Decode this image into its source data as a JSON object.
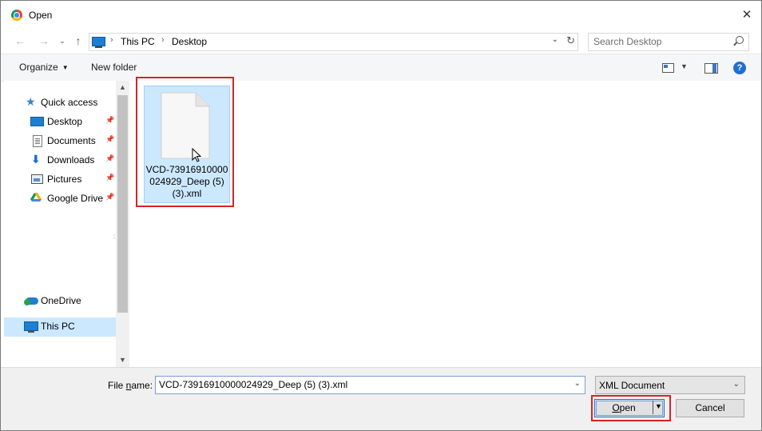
{
  "window": {
    "title": "Open",
    "close_label": "✕"
  },
  "address": {
    "breadcrumbs": [
      "This PC",
      "Desktop"
    ],
    "separator": "›"
  },
  "search": {
    "placeholder": "Search Desktop"
  },
  "toolbar": {
    "organize_label": "Organize",
    "new_folder_label": "New folder",
    "help_label": "?"
  },
  "sidebar": {
    "items": [
      {
        "label": "Quick access",
        "icon": "star-icon"
      },
      {
        "label": "Desktop",
        "icon": "desktop-icon",
        "pinned": true
      },
      {
        "label": "Documents",
        "icon": "documents-icon",
        "pinned": true
      },
      {
        "label": "Downloads",
        "icon": "downloads-icon",
        "pinned": true
      },
      {
        "label": "Pictures",
        "icon": "pictures-icon",
        "pinned": true
      },
      {
        "label": "Google Drive",
        "icon": "google-drive-icon",
        "pinned": true
      },
      {
        "label": "OneDrive",
        "icon": "onedrive-icon"
      },
      {
        "label": "This PC",
        "icon": "this-pc-icon",
        "selected": true
      }
    ]
  },
  "files": [
    {
      "name": "VCD-73916910000024929_Deep (5) (3).xml",
      "selected": true
    }
  ],
  "bottom": {
    "file_name_label_pre": "File ",
    "file_name_label_u": "n",
    "file_name_label_post": "ame:",
    "file_name_value": "VCD-73916910000024929_Deep (5) (3).xml",
    "file_type": "XML Document",
    "open_label_u": "O",
    "open_label_post": "pen",
    "cancel_label": "Cancel"
  },
  "colors": {
    "selection": "#cce8ff",
    "highlight": "#d8232a",
    "accent": "#1e6fd0"
  }
}
